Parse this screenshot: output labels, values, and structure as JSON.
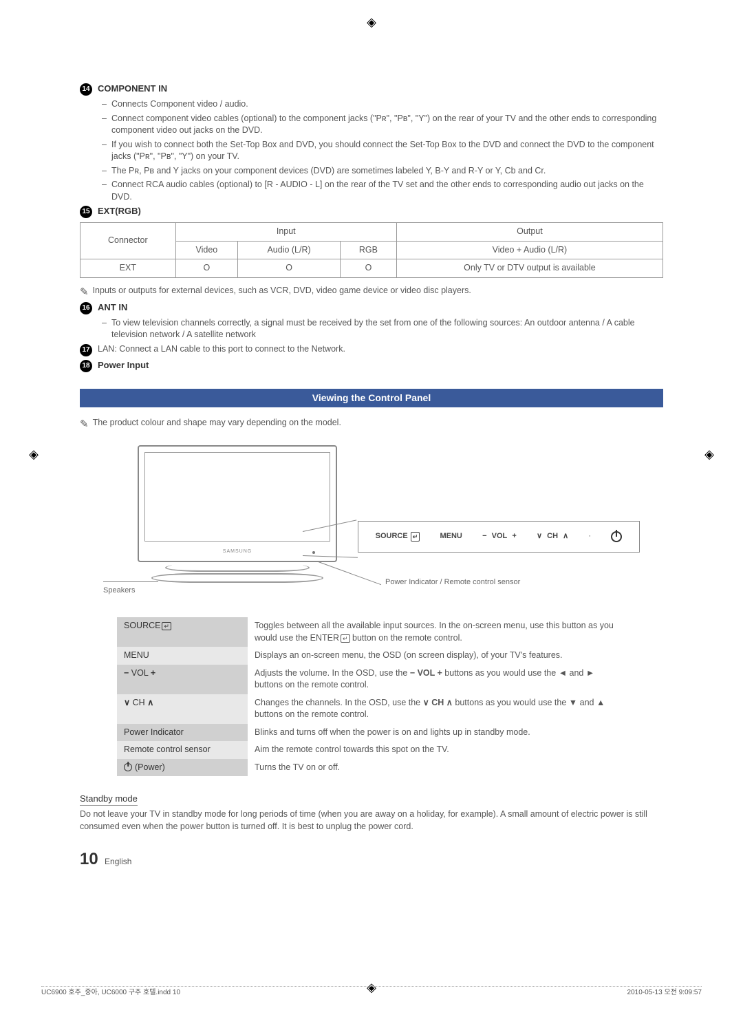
{
  "sections": {
    "s14": {
      "num": "14",
      "title": "COMPONENT IN",
      "bullets": [
        "Connects Component video / audio.",
        "Connect component video cables (optional) to the component jacks (\"Pʀ\", \"Pʙ\", \"Y\") on the rear of your TV and the other ends to corresponding component video out jacks on the DVD.",
        "If you wish to connect both the Set-Top Box and DVD, you should connect the Set-Top Box to the DVD and connect the DVD to the component jacks (\"Pʀ\", \"Pʙ\", \"Y\") on your TV.",
        "The Pʀ, Pʙ and Y jacks on your component devices (DVD) are sometimes labeled Y, B-Y and R-Y or Y, Cb and Cr.",
        "Connect RCA audio cables (optional) to [R - AUDIO - L] on the rear of the TV set and the other ends to corresponding audio out jacks on the DVD."
      ]
    },
    "s15": {
      "num": "15",
      "title": "EXT(RGB)"
    },
    "table": {
      "h_connector": "Connector",
      "h_input": "Input",
      "h_output": "Output",
      "h_video": "Video",
      "h_audio": "Audio (L/R)",
      "h_rgb": "RGB",
      "h_outval": "Video + Audio (L/R)",
      "row_label": "EXT",
      "c1": "O",
      "c2": "O",
      "c3": "O",
      "c_out": "Only TV or DTV output is available"
    },
    "note_ext": "Inputs or outputs for external devices, such as VCR, DVD, video game device or video disc players.",
    "s16": {
      "num": "16",
      "title": "ANT IN",
      "bullets": [
        "To view television channels correctly, a signal must be received by the set from one of the following sources: An outdoor antenna / A cable television network / A satellite network"
      ]
    },
    "s17": {
      "num": "17",
      "text": "LAN: Connect a LAN cable to this port to connect to the Network."
    },
    "s18": {
      "num": "18",
      "title": "Power Input"
    }
  },
  "header_bar": "Viewing the Control Panel",
  "note_color": "The product colour and shape may vary depending on the model.",
  "figure": {
    "brand": "SAMSUNG",
    "speakers_label": "Speakers",
    "sensor_label": "Power Indicator / Remote control sensor",
    "btn_source": "SOURCE",
    "btn_menu": "MENU",
    "btn_vol": "VOL",
    "btn_ch": "CH"
  },
  "control_rows": {
    "r1_label": "SOURCE",
    "r1_text": "Toggles between all the available input sources. In the on-screen menu, use this button as you would use the ENTER",
    "r1_text_tail": " button on the remote control.",
    "r2_label": "MENU",
    "r2_text": "Displays an on-screen menu, the OSD (on screen display), of your TV's features.",
    "r3_label_a": "VOL",
    "r3_text_a": "Adjusts the volume. In the OSD, use the ",
    "r3_text_b": " buttons as you would use the ◄ and ► buttons on the remote control.",
    "r4_label_a": "CH",
    "r4_text_a": "Changes the channels. In the OSD, use the ",
    "r4_text_b": " buttons as you would use the ▼ and ▲ buttons on the remote control.",
    "r5_label": "Power Indicator",
    "r5_text": "Blinks and turns off when the power is on and lights up in standby mode.",
    "r6_label": "Remote control sensor",
    "r6_text": "Aim the remote control towards this spot on the TV.",
    "r7_label": "(Power)",
    "r7_text": "Turns the TV on or off."
  },
  "standby": {
    "title": "Standby mode",
    "text": "Do not leave your TV in standby mode for long periods of time (when you are away on a holiday, for example). A small amount of electric power is still consumed even when the power button is turned off. It is best to unplug the power cord."
  },
  "page": {
    "num": "10",
    "lang": "English"
  },
  "footer": {
    "left": "UC6900 호주_중아, UC6000 구주 호텔.indd   10",
    "right": "2010-05-13   오전 9:09:57"
  }
}
